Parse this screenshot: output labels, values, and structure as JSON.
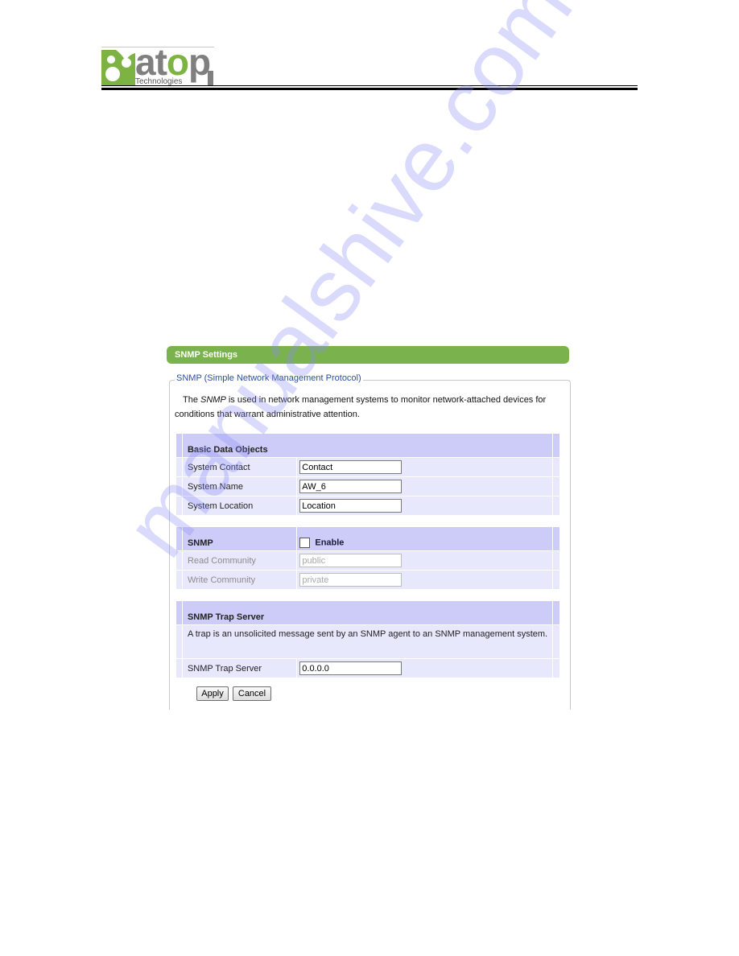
{
  "brand": {
    "logo_word": "atop",
    "logo_word_prefix": "at",
    "logo_word_o": "o",
    "logo_word_suffix": "p",
    "logo_subtitle": "Technologies",
    "colors": {
      "green": "#7cb342",
      "gray": "#7f7f7f"
    }
  },
  "panel": {
    "title": "SNMP Settings",
    "title_bar_color": "#7ab24e",
    "fieldset_legend": "SNMP (Simple Network Management Protocol)",
    "intro_before": "The ",
    "intro_em": "SNMP",
    "intro_after": " is used in network management systems to monitor network-attached devices for conditions that warrant administrative attention."
  },
  "basic_data_objects": {
    "header": "Basic Data Objects",
    "rows": [
      {
        "label": "System Contact",
        "value": "Contact"
      },
      {
        "label": "System Name",
        "value": "AW_6"
      },
      {
        "label": "System Location",
        "value": "Location"
      }
    ]
  },
  "snmp": {
    "header": "SNMP",
    "enable_label": "Enable",
    "enable_checked": false,
    "rows": [
      {
        "label": "Read Community",
        "value": "public",
        "disabled": true
      },
      {
        "label": "Write Community",
        "value": "private",
        "disabled": true
      }
    ]
  },
  "trap": {
    "header": "SNMP Trap Server",
    "description": "A trap is an unsolicited message sent by an SNMP agent to an SNMP management system.",
    "server_label": "SNMP Trap Server",
    "server_value": "0.0.0.0"
  },
  "buttons": {
    "apply": "Apply",
    "cancel": "Cancel"
  },
  "colors": {
    "table_header": "#cdccf8",
    "table_row": "#e8e8fd",
    "legend_text": "#2a4ea3"
  },
  "watermark": "manualshive.com"
}
